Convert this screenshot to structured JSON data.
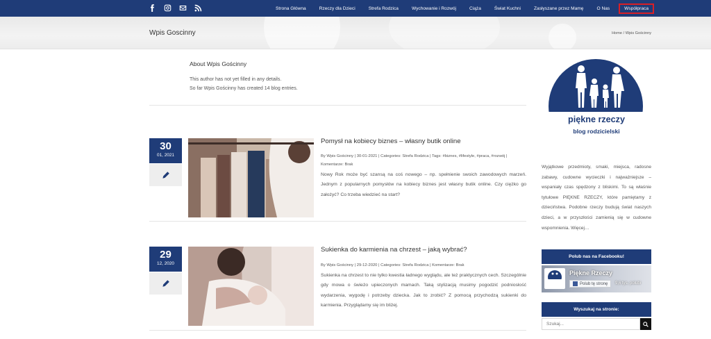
{
  "colors": {
    "brand_navy": "#1f3c78",
    "highlight_red": "#d91f26"
  },
  "social": [
    {
      "icon": "facebook-icon"
    },
    {
      "icon": "instagram-icon"
    },
    {
      "icon": "mail-icon"
    },
    {
      "icon": "rss-icon"
    }
  ],
  "nav": {
    "items": [
      "Strona Główna",
      "Rzeczy dla Dzieci",
      "Strefa Rodzica",
      "Wychowanie i Rozwój",
      "Ciąża",
      "Świat Kuchni",
      "Zasłyszane przez Mamę",
      "O Nas",
      "Współpraca"
    ]
  },
  "page": {
    "title": "Wpis Goscinny",
    "breadcrumb": "Home / Wpis Gościnny"
  },
  "author": {
    "title": "About Wpis Gościnny",
    "line1": "This author has not yet filled in any details.",
    "line2": "So far Wpis Gościnny has created 14 blog entries."
  },
  "posts": [
    {
      "day": "30",
      "month_year": "01, 2021",
      "title": "Pomysł na kobiecy biznes – własny butik online",
      "meta": "By Wpis Gościnny | 30-01-2021 | Categories: Strefa Rodzica | Tags: #biznes, #lifestyle, #praca, #rozwój | Komentarze: Brak",
      "excerpt": "Nowy Rok może być szansą na coś nowego – np. spełnienie swoich zawodowych marzeń. Jednym z popularnych pomysłów na kobiecy biznes jest własny butik online. Czy ciężko go założyć? Co trzeba wiedzieć na start?"
    },
    {
      "day": "29",
      "month_year": "12, 2020",
      "title": "Sukienka do karmienia na chrzest – jaką wybrać?",
      "meta": "By Wpis Gościnny | 29-12-2020 | Categories: Strefa Rodzica | Komentarze: Brak",
      "excerpt": "Sukienka na chrzest to nie tylko kwestia ładnego wyglądu, ale też praktycznych cech. Szczególnie gdy mowa o świeżo upieczonych mamach. Taką stylizacją musimy pogodzić podniosłość wydarzenia, wygodę i potrzeby dziecka. Jak to zrobić? Z pomocą przychodzą sukienki do karmienia. Przyglądamy się im bliżej."
    }
  ],
  "sidebar": {
    "logo_title": "piękne rzeczy",
    "logo_subtitle": "blog rodzicielski",
    "about": "Wyjątkowe przedmioty, smaki, miejsca, radosne zabawy, cudowne wycieczki i najważniejsze – wspaniały czas spędzony z bliskimi. To są właśnie tytułowe PIĘKNE RZECZY, które pamiętamy z dzieciństwa. Podobne rzeczy budują świat naszych dzieci, a w przyszłości zamienią się w cudowne wspomnienia. Więcej…",
    "facebook_heading": "Polub nas na Facebooku!",
    "facebook_page_name": "Piękne Rzeczy",
    "facebook_like_label": "Polub tę stronę",
    "facebook_likes": "9,6 tys. polubi",
    "search_heading": "Wyszukaj na stronie:",
    "search_placeholder": "Szukaj..."
  }
}
